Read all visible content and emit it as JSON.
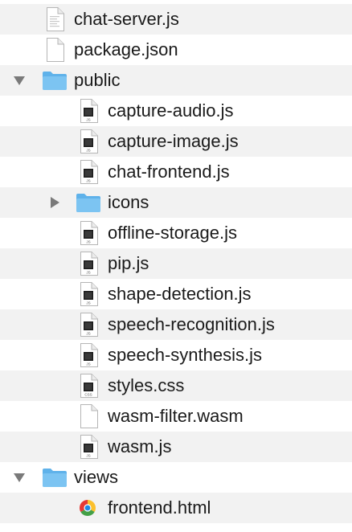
{
  "file_tree": [
    {
      "name": "chat-server.js",
      "kind": "file-js-partial",
      "depth": 0
    },
    {
      "name": "package.json",
      "kind": "file-blank",
      "depth": 0
    },
    {
      "name": "public",
      "kind": "folder",
      "depth": 0,
      "expanded": true
    },
    {
      "name": "capture-audio.js",
      "kind": "file-js",
      "depth": 1
    },
    {
      "name": "capture-image.js",
      "kind": "file-js",
      "depth": 1
    },
    {
      "name": "chat-frontend.js",
      "kind": "file-js",
      "depth": 1
    },
    {
      "name": "icons",
      "kind": "folder",
      "depth": 1,
      "expanded": false
    },
    {
      "name": "offline-storage.js",
      "kind": "file-js",
      "depth": 1
    },
    {
      "name": "pip.js",
      "kind": "file-js",
      "depth": 1
    },
    {
      "name": "shape-detection.js",
      "kind": "file-js",
      "depth": 1
    },
    {
      "name": "speech-recognition.js",
      "kind": "file-js",
      "depth": 1
    },
    {
      "name": "speech-synthesis.js",
      "kind": "file-js",
      "depth": 1
    },
    {
      "name": "styles.css",
      "kind": "file-css",
      "depth": 1
    },
    {
      "name": "wasm-filter.wasm",
      "kind": "file-blank",
      "depth": 1
    },
    {
      "name": "wasm.js",
      "kind": "file-js",
      "depth": 1
    },
    {
      "name": "views",
      "kind": "folder",
      "depth": 0,
      "expanded": true
    },
    {
      "name": "frontend.html",
      "kind": "file-html-chrome",
      "depth": 1
    }
  ],
  "colors": {
    "row_alt": "#f2f2f2",
    "folder_front": "#7cc4f2",
    "folder_back": "#5fb2ea",
    "disclosure": "#7a7a7a"
  }
}
